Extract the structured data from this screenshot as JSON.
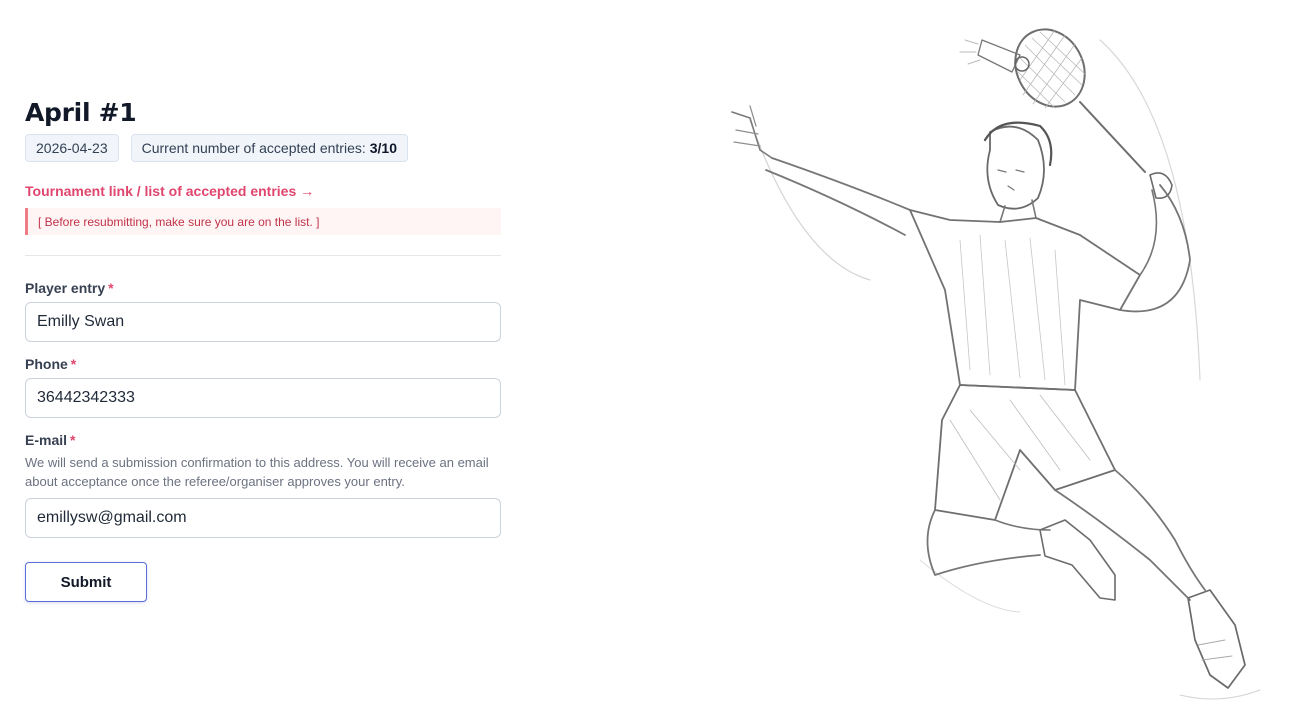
{
  "event": {
    "title": "April #1",
    "date": "2026-04-23",
    "entries_label": "Current number of accepted entries:",
    "entries_value": "3/10"
  },
  "link": {
    "text": "Tournament link / list of accepted entries →"
  },
  "notice": {
    "text": "[ Before resubmitting, make sure you are on the list. ]"
  },
  "form": {
    "player": {
      "label": "Player entry",
      "required_mark": "*",
      "value": "Emilly Swan"
    },
    "phone": {
      "label": "Phone",
      "required_mark": "*",
      "value": "36442342333"
    },
    "email": {
      "label": "E-mail",
      "required_mark": "*",
      "hint": "We will send a submission confirmation to this address. You will receive an email about acceptance once the referee/organiser approves your entry.",
      "value": "emillysw@gmail.com"
    },
    "submit_label": "Submit"
  },
  "colors": {
    "accent_link": "#e0466d",
    "notice_border": "#ef7d88",
    "submit_border": "#5b6fd6"
  },
  "illustration": {
    "icon": "badminton-player-sketch-icon"
  }
}
